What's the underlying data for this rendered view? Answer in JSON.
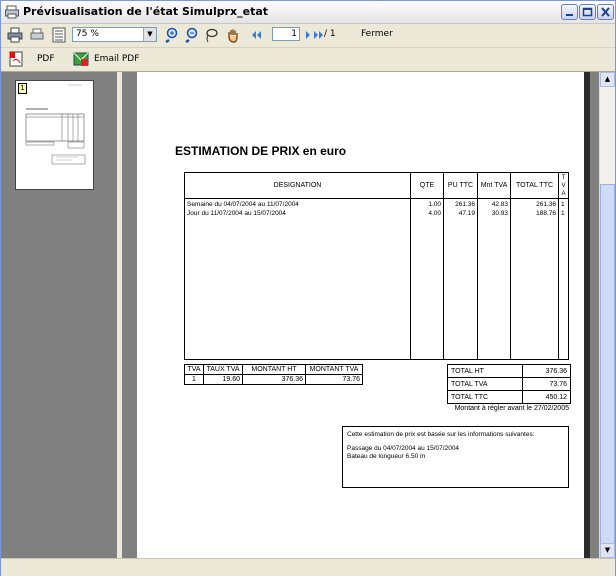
{
  "window": {
    "title": "Prévisualisation de l'état Simulprx_etat"
  },
  "toolbar": {
    "zoom_value": "75 %",
    "page_current": "1",
    "page_total": "/ 1",
    "close_label": "Fermer",
    "pdf_label": "PDF",
    "email_pdf_label": "Email PDF"
  },
  "thumbnail": {
    "page_number": "1"
  },
  "report": {
    "title": "ESTIMATION DE PRIX en euro",
    "columns": {
      "designation": "DESIGNATION",
      "qte": "QTE",
      "pu_ttc": "PU TTC",
      "mnt_tva": "Mnt TVA",
      "total_ttc": "TOTAL TTC",
      "tva": [
        "T",
        "V",
        "A"
      ]
    },
    "rows": [
      {
        "designation": "Semaine du 04/07/2004 au 11/07/2004",
        "qte": "1.00",
        "pu_ttc": "261.36",
        "mnt_tva": "42.83",
        "total_ttc": "261.36",
        "tva": "1"
      },
      {
        "designation": "Jour du 11/07/2004 au 15/07/2004",
        "qte": "4.00",
        "pu_ttc": "47.19",
        "mnt_tva": "30.93",
        "total_ttc": "188.76",
        "tva": "1"
      }
    ],
    "vat": {
      "headers": [
        "TVA",
        "TAUX TVA",
        "MONTANT HT",
        "MONTANT TVA"
      ],
      "row": [
        "1",
        "19.60",
        "376.36",
        "73.76"
      ]
    },
    "totals": {
      "ht_label": "TOTAL HT",
      "ht_value": "376.36",
      "tva_label": "TOTAL TVA",
      "tva_value": "73.76",
      "ttc_label": "TOTAL TTC",
      "ttc_value": "450.12"
    },
    "due_text": "Montant à régler avant le 27/02/2005",
    "info": {
      "line1": "Cette estimation de prix est basée sur les informations suivantes:",
      "line2": "Passage du 04/07/2004 au 15/07/2004",
      "line3": "Bateau de longueur 6.50 m"
    }
  },
  "colors": {
    "accent": "#0a5de5",
    "panel": "#808080",
    "chrome": "#ece9d8"
  }
}
